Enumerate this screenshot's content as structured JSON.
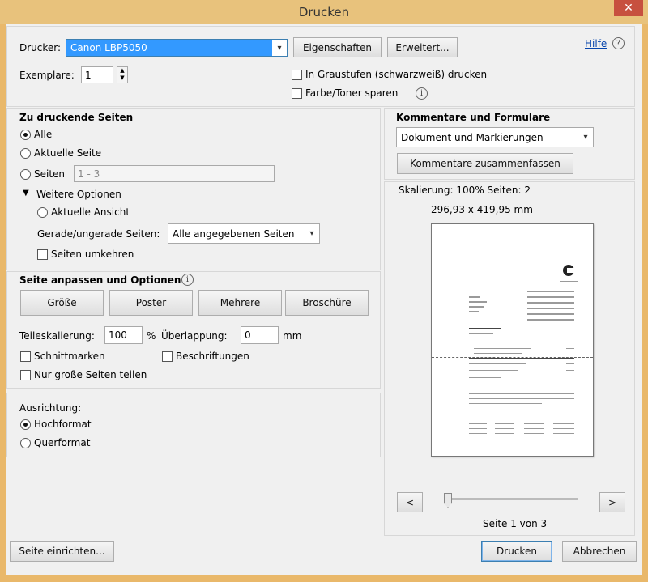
{
  "window": {
    "title": "Drucken",
    "close_glyph": "✕"
  },
  "printer": {
    "label": "Drucker:",
    "value": "Canon LBP5050",
    "properties_button": "Eigenschaften",
    "advanced_button": "Erweitert...",
    "help_link": "Hilfe",
    "help_glyph": "?"
  },
  "copies": {
    "label": "Exemplare:",
    "value": "1"
  },
  "options": {
    "grayscale": "In Graustufen (schwarzweiß) drucken",
    "save_toner": "Farbe/Toner sparen",
    "info_glyph": "i"
  },
  "pages": {
    "title": "Zu druckende Seiten",
    "all": "Alle",
    "current": "Aktuelle Seite",
    "pages": "Seiten",
    "pages_value": "1 - 3",
    "more_options": "Weitere Optionen",
    "more_options_glyph": "▼",
    "current_view": "Aktuelle Ansicht",
    "odd_even_label": "Gerade/ungerade Seiten:",
    "odd_even_value": "Alle angegebenen Seiten",
    "reverse": "Seiten umkehren"
  },
  "sizing": {
    "title": "Seite anpassen und Optionen",
    "size_button": "Größe",
    "poster_button": "Poster",
    "multiple_button": "Mehrere",
    "booklet_button": "Broschüre",
    "tile_scale_label": "Teileskalierung:",
    "tile_scale_value": "100",
    "percent": "%",
    "overlap_label": "Überlappung:",
    "overlap_value": "0",
    "mm": "mm",
    "cut_marks": "Schnittmarken",
    "labels": "Beschriftungen",
    "large_pages_only": "Nur große Seiten teilen"
  },
  "orientation": {
    "title": "Ausrichtung:",
    "portrait": "Hochformat",
    "landscape": "Querformat"
  },
  "comments": {
    "title": "Kommentare und Formulare",
    "value": "Dokument und Markierungen",
    "summarize_button": "Kommentare zusammenfassen"
  },
  "preview": {
    "scaling": "Skalierung: 100% Seiten: 2",
    "dimensions": "296,93 x 419,95 mm",
    "prev_glyph": "<",
    "next_glyph": ">",
    "page_status": "Seite 1 von 3",
    "slider_position": 0
  },
  "footer": {
    "page_setup_button": "Seite einrichten...",
    "print_button": "Drucken",
    "cancel_button": "Abbrechen"
  },
  "arrow_glyph": "▾",
  "spin_up": "▲",
  "spin_down": "▼"
}
